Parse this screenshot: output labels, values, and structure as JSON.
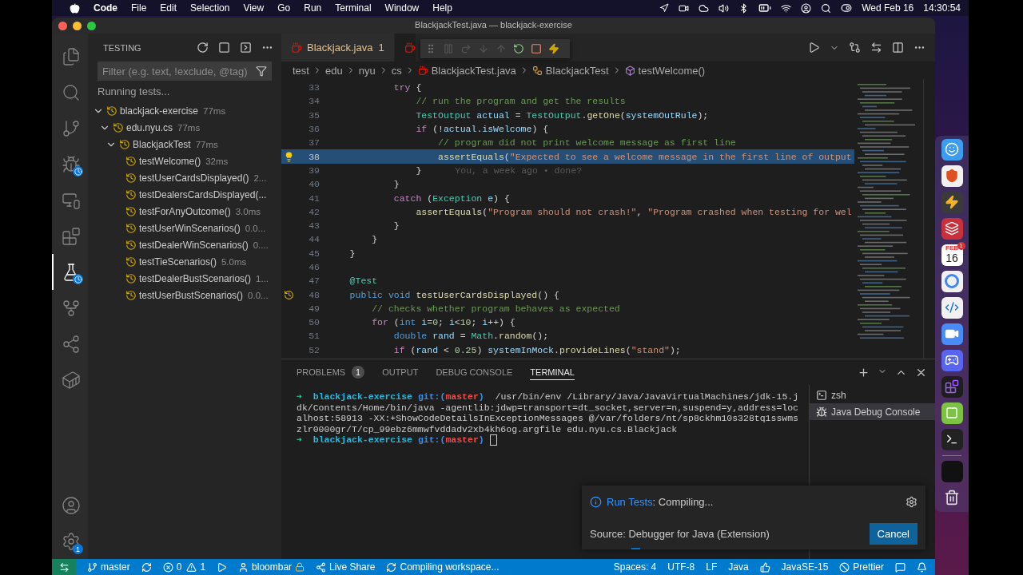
{
  "menubar": {
    "app": "Code",
    "menus": [
      "File",
      "Edit",
      "Selection",
      "View",
      "Go",
      "Run",
      "Terminal",
      "Window",
      "Help"
    ],
    "date": "Wed Feb 16",
    "time": "14:30:54"
  },
  "window": {
    "title": "BlackjackTest.java — blackjack-exercise"
  },
  "activity_bar": {
    "items": [
      {
        "kind": "files",
        "selected": false,
        "busy": false
      },
      {
        "kind": "search",
        "selected": false,
        "busy": false
      },
      {
        "kind": "source-control",
        "selected": false,
        "busy": false
      },
      {
        "kind": "run-debug",
        "selected": false,
        "busy": true
      },
      {
        "kind": "remote",
        "selected": false,
        "busy": false
      },
      {
        "kind": "extensions",
        "selected": false,
        "busy": false
      },
      {
        "kind": "testing",
        "selected": true,
        "busy": true
      },
      {
        "kind": "graph",
        "selected": false,
        "busy": false
      },
      {
        "kind": "share",
        "selected": false,
        "busy": false
      },
      {
        "kind": "docker",
        "selected": false,
        "busy": false
      }
    ],
    "settings_badge": "1"
  },
  "sidebar": {
    "title": "TESTING",
    "filter": {
      "placeholder": "Filter (e.g. text, !exclude, @tag)"
    },
    "status": "Running tests...",
    "tree": [
      {
        "label": "blackjack-exercise",
        "duration": "77ms",
        "expanded": true,
        "children": [
          {
            "label": "edu.nyu.cs",
            "duration": "77ms",
            "expanded": true,
            "children": [
              {
                "label": "BlackjackTest",
                "duration": "77ms",
                "expanded": true,
                "children": [
                  {
                    "label": "testWelcome()",
                    "duration": "32ms"
                  },
                  {
                    "label": "testUserCardsDisplayed()",
                    "duration": "2..."
                  },
                  {
                    "label": "testDealersCardsDisplayed(..."
                  },
                  {
                    "label": "testForAnyOutcome()",
                    "duration": "3.0ms"
                  },
                  {
                    "label": "testUserWinScenarios()",
                    "duration": "0.0..."
                  },
                  {
                    "label": "testDealerWinScenarios()",
                    "duration": "0...."
                  },
                  {
                    "label": "testTieScenarios()",
                    "duration": "5.0ms"
                  },
                  {
                    "label": "testDealerBustScenarios()",
                    "duration": "1..."
                  },
                  {
                    "label": "testUserBustScenarios()",
                    "duration": "0.0..."
                  }
                ]
              }
            ]
          }
        ]
      }
    ]
  },
  "editor": {
    "tabs": [
      {
        "label": "Blackjack.java",
        "problems": "1",
        "selected": false
      },
      {
        "selected": true
      }
    ],
    "breadcrumbs": [
      {
        "label": "test",
        "kind": "folder"
      },
      {
        "label": "edu",
        "kind": "folder"
      },
      {
        "label": "nyu",
        "kind": "folder"
      },
      {
        "label": "cs",
        "kind": "folder"
      },
      {
        "label": "BlackjackTest.java",
        "kind": "file"
      },
      {
        "label": "BlackjackTest",
        "kind": "class"
      },
      {
        "label": "testWelcome()",
        "kind": "method"
      }
    ],
    "lines": [
      {
        "number": "33",
        "kind": "plain",
        "highlighted": false,
        "tokens": [
          {
            "kind": "ctl",
            "text": "            try"
          },
          {
            "kind": "pl",
            "text": " {"
          }
        ]
      },
      {
        "number": "34",
        "kind": "plain",
        "highlighted": false,
        "tokens": [
          {
            "kind": "cm",
            "text": "                // run the program and get the results"
          }
        ]
      },
      {
        "number": "35",
        "kind": "plain",
        "highlighted": false,
        "tokens": [
          {
            "kind": "ty",
            "text": "                TestOutput"
          },
          {
            "kind": "var",
            "text": " actual"
          },
          {
            "kind": "pl",
            "text": " = "
          },
          {
            "kind": "ty",
            "text": "TestOutput"
          },
          {
            "kind": "pl",
            "text": "."
          },
          {
            "kind": "fn",
            "text": "getOne"
          },
          {
            "kind": "pl",
            "text": "("
          },
          {
            "kind": "var",
            "text": "systemOutRule"
          },
          {
            "kind": "pl",
            "text": ");"
          }
        ]
      },
      {
        "number": "36",
        "kind": "plain",
        "highlighted": false,
        "tokens": [
          {
            "kind": "ctl",
            "text": "                if"
          },
          {
            "kind": "pl",
            "text": " (!"
          },
          {
            "kind": "var",
            "text": "actual"
          },
          {
            "kind": "pl",
            "text": "."
          },
          {
            "kind": "var",
            "text": "isWelcome"
          },
          {
            "kind": "pl",
            "text": ") {"
          }
        ]
      },
      {
        "number": "37",
        "kind": "plain",
        "highlighted": false,
        "tokens": [
          {
            "kind": "cm",
            "text": "                    // program did not print welcome message as first line"
          }
        ]
      },
      {
        "number": "38",
        "kind": "lightbulb",
        "highlighted": true,
        "tokens": [
          {
            "kind": "fn",
            "text": "                    assertEquals"
          },
          {
            "kind": "pl",
            "text": "("
          },
          {
            "kind": "str",
            "text": "\"Expected to see a welcome message in the first line of output"
          }
        ]
      },
      {
        "number": "39",
        "kind": "plain",
        "highlighted": false,
        "tokens": [
          {
            "kind": "pl",
            "text": "                }"
          }
        ],
        "blame": "You, a week ago • done?"
      },
      {
        "number": "40",
        "kind": "plain",
        "highlighted": false,
        "tokens": [
          {
            "kind": "pl",
            "text": "            }"
          }
        ]
      },
      {
        "number": "41",
        "kind": "plain",
        "highlighted": false,
        "tokens": [
          {
            "kind": "ctl",
            "text": "            catch"
          },
          {
            "kind": "pl",
            "text": " ("
          },
          {
            "kind": "ty",
            "text": "Exception"
          },
          {
            "kind": "var",
            "text": " e"
          },
          {
            "kind": "pl",
            "text": ") {"
          }
        ]
      },
      {
        "number": "42",
        "kind": "plain",
        "highlighted": false,
        "tokens": [
          {
            "kind": "fn",
            "text": "                assertEquals"
          },
          {
            "kind": "pl",
            "text": "("
          },
          {
            "kind": "str",
            "text": "\"Program should not crash!\""
          },
          {
            "kind": "pl",
            "text": ", "
          },
          {
            "kind": "str",
            "text": "\"Program crashed when testing for wel"
          }
        ]
      },
      {
        "number": "43",
        "kind": "plain",
        "highlighted": false,
        "tokens": [
          {
            "kind": "pl",
            "text": "            }"
          }
        ]
      },
      {
        "number": "44",
        "kind": "plain",
        "highlighted": false,
        "tokens": [
          {
            "kind": "pl",
            "text": "        }"
          }
        ]
      },
      {
        "number": "45",
        "kind": "plain",
        "highlighted": false,
        "tokens": [
          {
            "kind": "pl",
            "text": "    }"
          }
        ]
      },
      {
        "number": "46",
        "kind": "plain",
        "highlighted": false
      },
      {
        "number": "47",
        "kind": "plain",
        "highlighted": false,
        "tokens": [
          {
            "kind": "ann",
            "text": "    @Test"
          }
        ]
      },
      {
        "number": "48",
        "kind": "test",
        "highlighted": false,
        "tokens": [
          {
            "kind": "kw",
            "text": "    public void"
          },
          {
            "kind": "fn",
            "text": " testUserCardsDisplayed"
          },
          {
            "kind": "pl",
            "text": "() {"
          }
        ]
      },
      {
        "number": "49",
        "kind": "plain",
        "highlighted": false,
        "tokens": [
          {
            "kind": "cm",
            "text": "        // checks whether program behaves as expected"
          }
        ]
      },
      {
        "number": "50",
        "kind": "plain",
        "highlighted": false,
        "tokens": [
          {
            "kind": "ctl",
            "text": "        for"
          },
          {
            "kind": "pl",
            "text": " ("
          },
          {
            "kind": "kw",
            "text": "int"
          },
          {
            "kind": "var",
            "text": " i"
          },
          {
            "kind": "pl",
            "text": "="
          },
          {
            "kind": "num",
            "text": "0"
          },
          {
            "kind": "pl",
            "text": "; "
          },
          {
            "kind": "var",
            "text": "i"
          },
          {
            "kind": "pl",
            "text": "<"
          },
          {
            "kind": "num",
            "text": "10"
          },
          {
            "kind": "pl",
            "text": "; "
          },
          {
            "kind": "var",
            "text": "i"
          },
          {
            "kind": "pl",
            "text": "++) {"
          }
        ]
      },
      {
        "number": "51",
        "kind": "plain",
        "highlighted": false,
        "tokens": [
          {
            "kind": "kw",
            "text": "            double"
          },
          {
            "kind": "var",
            "text": " rand"
          },
          {
            "kind": "pl",
            "text": " = "
          },
          {
            "kind": "ty",
            "text": "Math"
          },
          {
            "kind": "pl",
            "text": "."
          },
          {
            "kind": "fn",
            "text": "random"
          },
          {
            "kind": "pl",
            "text": "();"
          }
        ]
      },
      {
        "number": "52",
        "kind": "plain",
        "highlighted": false,
        "tokens": [
          {
            "kind": "ctl",
            "text": "            if"
          },
          {
            "kind": "pl",
            "text": " ("
          },
          {
            "kind": "var",
            "text": "rand"
          },
          {
            "kind": "pl",
            "text": " < "
          },
          {
            "kind": "num",
            "text": "0.25"
          },
          {
            "kind": "pl",
            "text": ") "
          },
          {
            "kind": "var",
            "text": "systemInMock"
          },
          {
            "kind": "pl",
            "text": "."
          },
          {
            "kind": "fn",
            "text": "provideLines"
          },
          {
            "kind": "pl",
            "text": "("
          },
          {
            "kind": "str",
            "text": "\"stand\""
          },
          {
            "kind": "pl",
            "text": ");"
          }
        ]
      }
    ]
  },
  "panel": {
    "tabs": [
      {
        "label": "PROBLEMS",
        "count": "1",
        "selected": false
      },
      {
        "label": "OUTPUT",
        "selected": false
      },
      {
        "label": "DEBUG CONSOLE",
        "selected": false
      },
      {
        "label": "TERMINAL",
        "selected": true
      }
    ],
    "terminal": {
      "lines": [
        {
          "prompt": {
            "arrow": "➜",
            "dir": "blackjack-exercise",
            "git": "git:(",
            "branch": "master",
            "close": ")"
          },
          "text": "  /usr/bin/env /Library/Java/JavaVirtualMachines/jdk-15.j",
          "cursor": false
        },
        {
          "text": "dk/Contents/Home/bin/java -agentlib:jdwp=transport=dt_socket,server=n,suspend=y,address=loc",
          "cursor": false
        },
        {
          "text": "alhost:58913 -XX:+ShowCodeDetailsInExceptionMessages @/var/folders/nt/sp8ckhm10s328tq1sswms",
          "cursor": false
        },
        {
          "text": "zlr0000gr/T/cp_99ebz6mmwfvddadv2xb4kh6og.argfile edu.nyu.cs.Blackjack",
          "cursor": false
        },
        {
          "prompt": {
            "arrow": "➜",
            "dir": "blackjack-exercise",
            "git": "git:(",
            "branch": "master",
            "close": ")"
          },
          "cursor": true
        }
      ]
    },
    "sessions": [
      {
        "label": "zsh",
        "kind": "shell",
        "selected": false
      },
      {
        "label": "Java Debug Console",
        "kind": "debug",
        "selected": true
      }
    ]
  },
  "notification": {
    "source": "Run Tests",
    "message": ": Compiling...",
    "detail": "Source: Debugger for Java (Extension)",
    "action": "Cancel",
    "progress": {
      "level": 0.03
    }
  },
  "status_bar": {
    "branch": "master",
    "errors": "0",
    "warnings": "1",
    "user": "bloombar",
    "live_share": "Live Share",
    "task": "Compiling workspace...",
    "spaces": "Spaces: 4",
    "encoding": "UTF-8",
    "eol": "LF",
    "language": "Java",
    "runtime": "JavaSE-15",
    "formatter": "Prettier"
  },
  "dock": {
    "calendar_month": "FEB",
    "calendar_day": "16",
    "calendar_badge": "1"
  }
}
